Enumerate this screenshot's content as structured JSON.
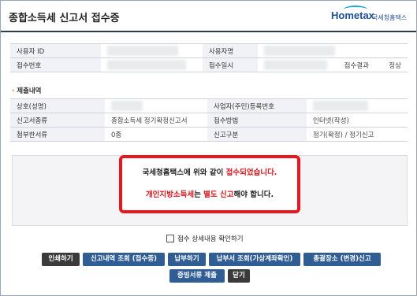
{
  "header": {
    "title": "종합소득세 신고서 접수증",
    "logo_wordmark": "Hometax",
    "logo_ko": "국세청홈택스"
  },
  "submitter": {
    "user_id_label": "사용자 ID",
    "user_name_label": "사용자명",
    "receipt_no_label": "접수번호",
    "receipt_datetime_label": "접수일시",
    "receipt_result_label": "접수결과",
    "receipt_result_value": "정상"
  },
  "section": {
    "title": "제출내역"
  },
  "details": {
    "trade_name_label": "상호(성명)",
    "reg_no_label": "사업자(주민)등록번호",
    "return_type_label": "신고서종류",
    "return_type_value": "종합소득세 정기확정신고서",
    "method_label": "접수방법",
    "method_value": "인터넷(작성)",
    "attachments_label": "첨부한서류",
    "attachments_value": "0종",
    "category_label": "신고구분",
    "category_value": "정기(확정) / 정기신고"
  },
  "notice": {
    "line1_pre": "국세청홈택스에 위와 같이 ",
    "line1_red": "접수되었습니다.",
    "line2_red1": "개인지방소득세",
    "line2_mid": "는 ",
    "line2_red2": "별도 신고",
    "line2_post": "해야 합니다."
  },
  "confirm_checkbox_label": "접수 상세내용 확인하기",
  "buttons": {
    "print": "인쇄하기",
    "history": "신고내역 조회 (접수증)",
    "pay": "납부하기",
    "virtual_account": "납부서 조회(가상계좌확인)",
    "local_tax": "총괄장소 (변경)신고",
    "submit_docs": "증빙서류 제출",
    "close": "닫기"
  },
  "colors": {
    "accent_red": "#e8161f",
    "button_blue": "#2f5d94",
    "button_dark": "#3a3a3a"
  }
}
